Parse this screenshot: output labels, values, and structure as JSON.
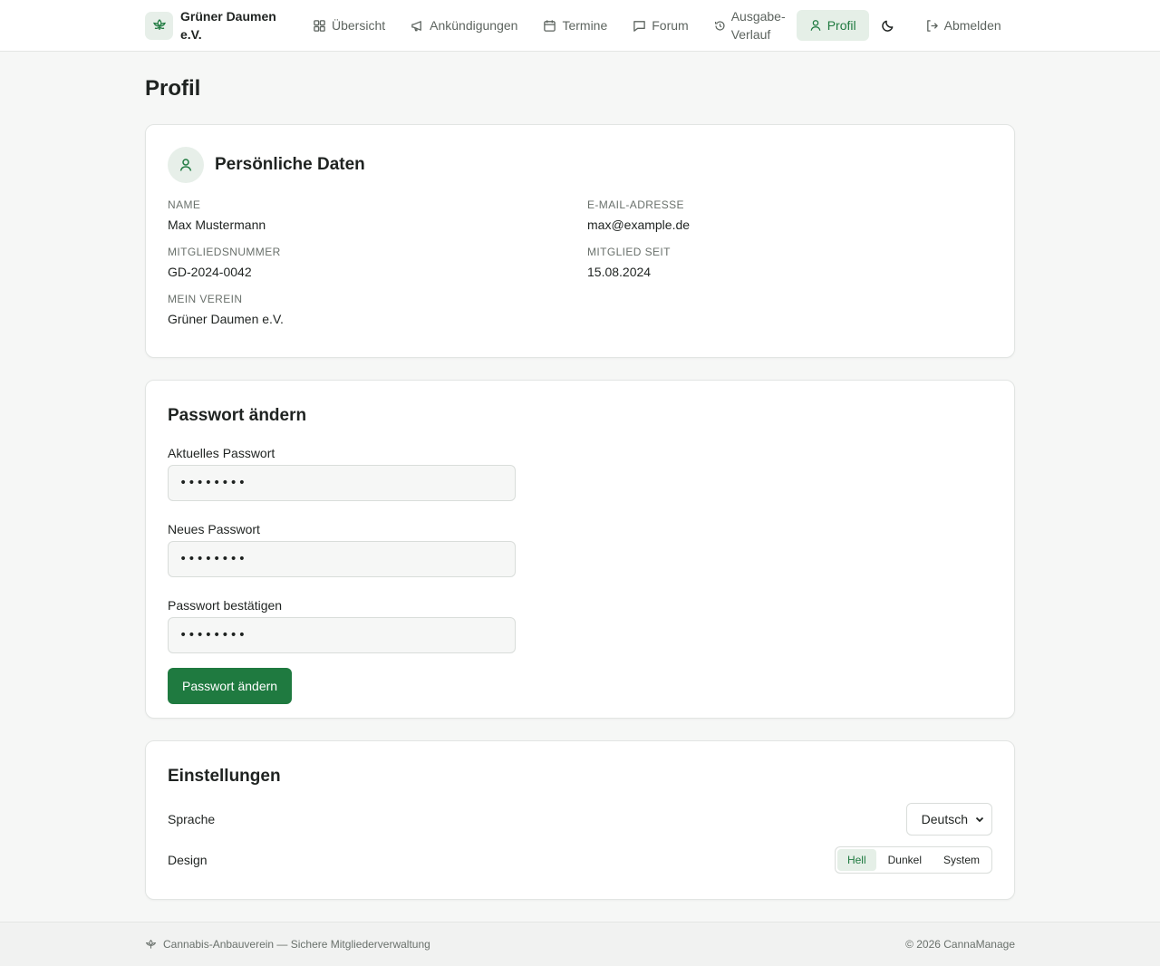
{
  "brand": {
    "name": "Grüner Daumen e.V.",
    "icon": "cannabis-leaf-icon"
  },
  "nav": {
    "items": [
      {
        "label": "Übersicht",
        "icon": "grid-icon"
      },
      {
        "label": "Ankündigungen",
        "icon": "megaphone-icon"
      },
      {
        "label": "Termine",
        "icon": "calendar-icon"
      },
      {
        "label": "Forum",
        "icon": "chat-bubble-icon"
      },
      {
        "label": "Ausgabe-Verlauf",
        "icon": "history-icon"
      },
      {
        "label": "Profil",
        "icon": "user-icon",
        "active": true
      }
    ],
    "logout": "Abmelden"
  },
  "page": {
    "title": "Profil"
  },
  "personal": {
    "title": "Persönliche Daten",
    "name_label": "Name",
    "name": "Max Mustermann",
    "email_label": "E-Mail-Adresse",
    "email": "max@example.de",
    "member_no_label": "Mitgliedsnummer",
    "member_no": "GD-2024-0042",
    "member_since_label": "Mitglied seit",
    "member_since": "15.08.2024",
    "club_label": "Mein Verein",
    "club": "Grüner Daumen e.V."
  },
  "password": {
    "title": "Passwort ändern",
    "current_label": "Aktuelles Passwort",
    "current_value": "••••••••",
    "new_label": "Neues Passwort",
    "new_value": "••••••••",
    "confirm_label": "Passwort bestätigen",
    "confirm_value": "••••••••",
    "submit": "Passwort ändern"
  },
  "settings": {
    "title": "Einstellungen",
    "language_label": "Sprache",
    "language_value": "Deutsch",
    "design_label": "Design",
    "design_options": [
      "Hell",
      "Dunkel",
      "System"
    ],
    "design_selected": "Hell"
  },
  "footer": {
    "left": "Cannabis-Anbauverein — Sichere Mitgliederverwaltung",
    "right": "© 2026 CannaManage"
  },
  "colors": {
    "accent": "#1f7a40",
    "accent_soft": "#e5efe7",
    "background": "#f6f7f6"
  }
}
